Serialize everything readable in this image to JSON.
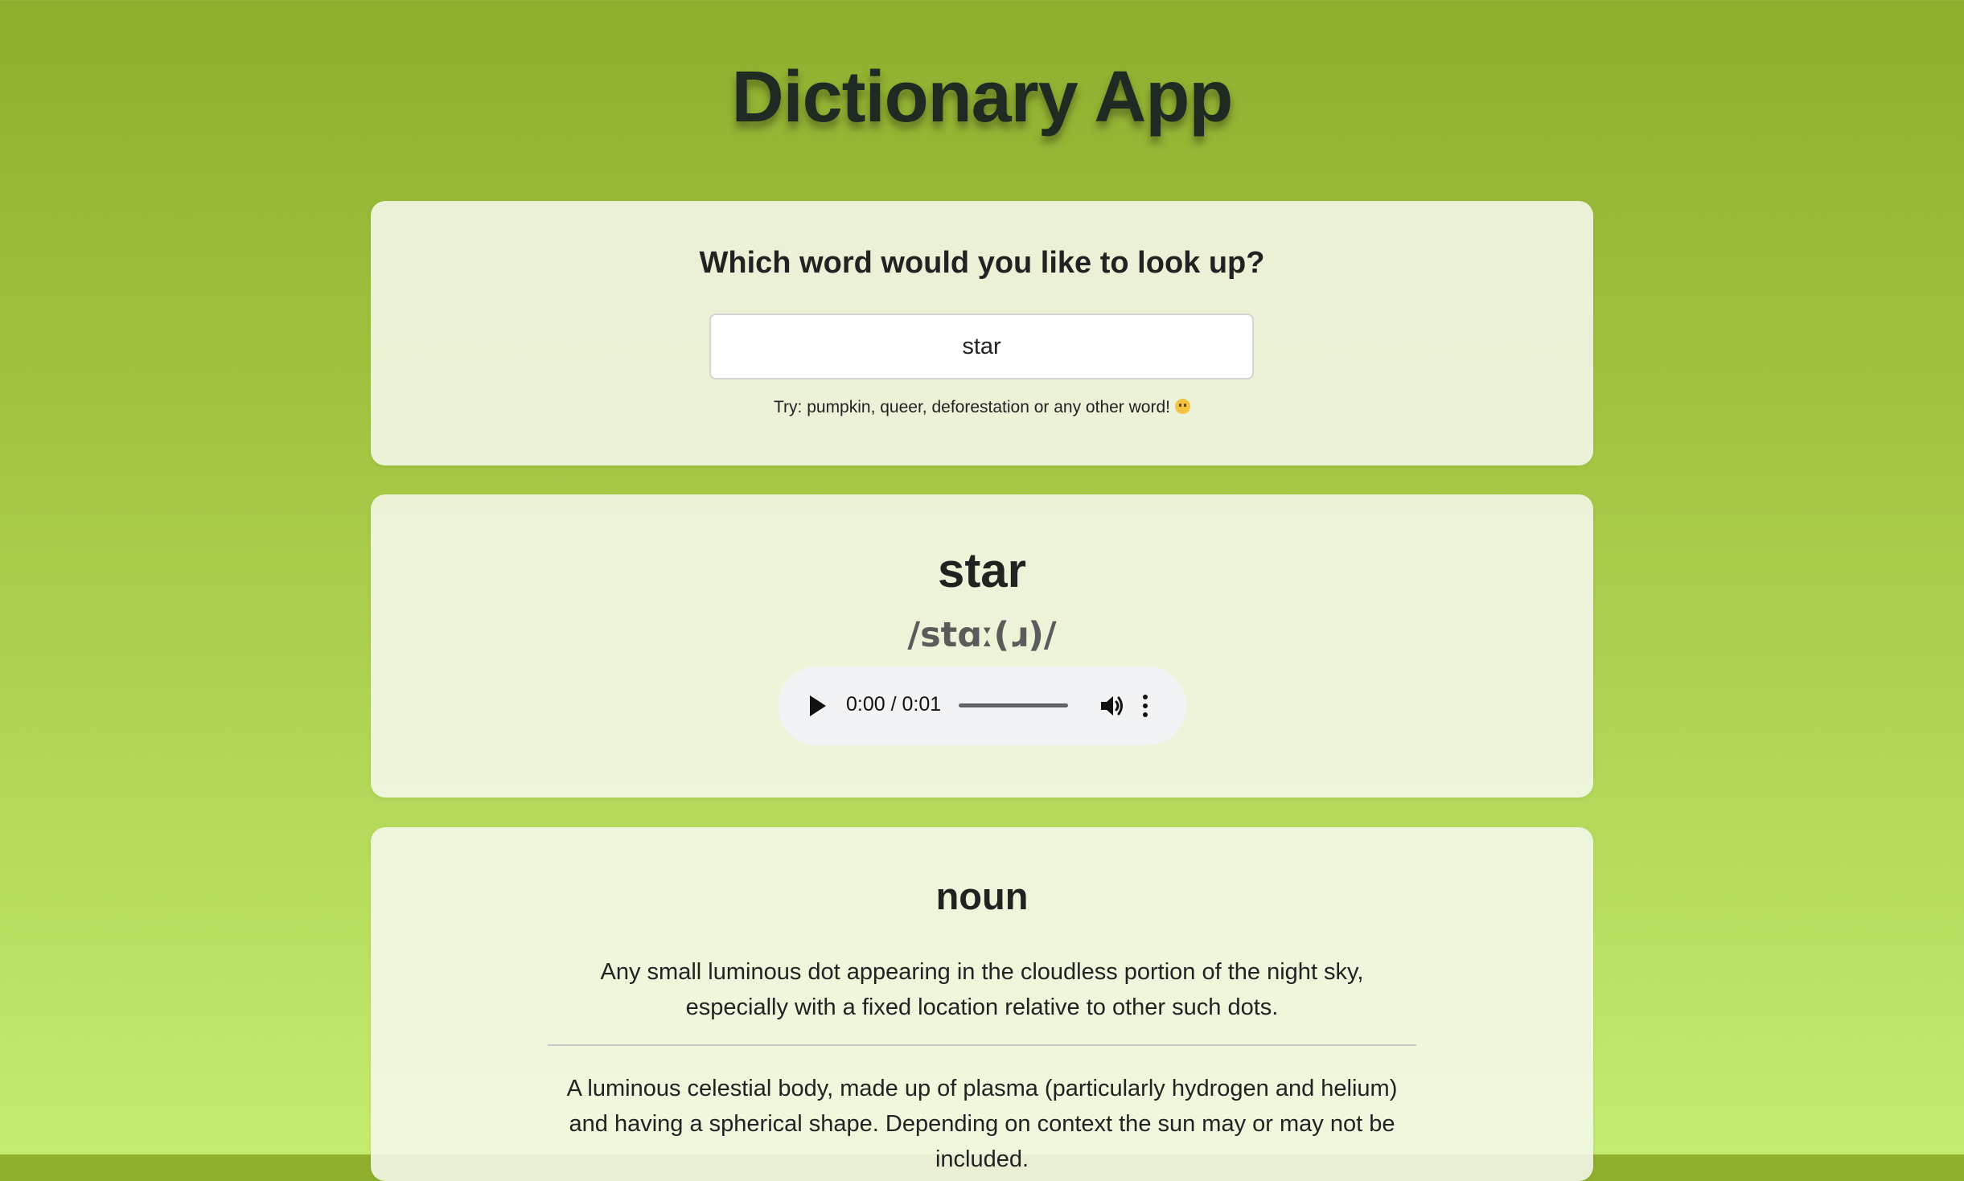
{
  "app": {
    "title": "Dictionary App"
  },
  "search": {
    "heading": "Which word would you like to look up?",
    "value": "star",
    "hint": "Try: pumpkin, queer, deforestation or any other word!",
    "hint_emoji_icon": "smiling-face-emoji"
  },
  "word": {
    "text": "star",
    "phonetic": "/stɑː(ɹ)/",
    "audio": {
      "time": "0:00 / 0:01",
      "progress": 0,
      "icons": [
        "play-icon",
        "volume-icon",
        "more-options-icon"
      ]
    }
  },
  "meaning": {
    "part_of_speech": "noun",
    "definitions": [
      "Any small luminous dot appearing in the cloudless portion of the night sky, especially with a fixed location relative to other such dots.",
      "A luminous celestial body, made up of plasma (particularly hydrogen and helium) and having a spherical shape. Depending on context the sun may or may not be included."
    ]
  },
  "colors": {
    "background_top": "#8fae2e",
    "background_bottom": "#c4ec70",
    "card": "#f5f8ec",
    "title_text": "#1e2a22",
    "phonetic_text": "#5b5b5b",
    "audio_bg": "#f1f3f4"
  }
}
